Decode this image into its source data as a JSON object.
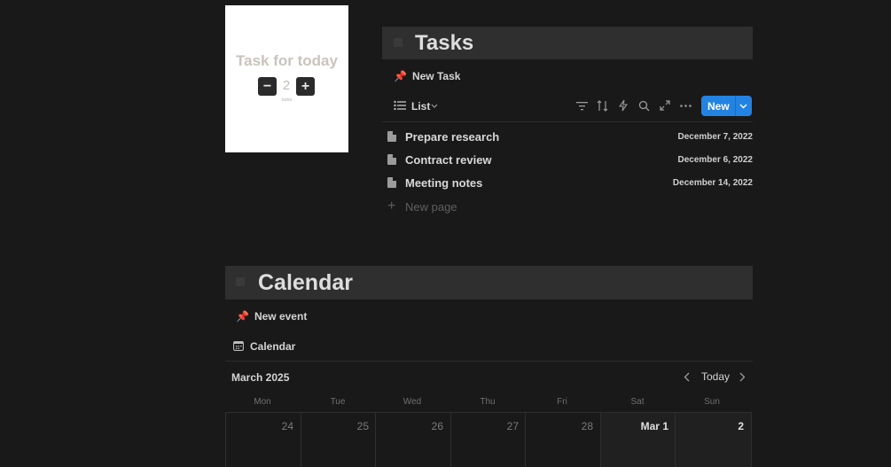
{
  "counter_widget": {
    "title": "Task for today",
    "value": "2",
    "minus_label": "−",
    "plus_label": "+",
    "sub_label": "tasks"
  },
  "tasks_section": {
    "title": "Tasks",
    "pinned_label": "New Task",
    "view_label": "List",
    "new_button_label": "New",
    "items": [
      {
        "title": "Prepare research",
        "date": "December 7, 2022"
      },
      {
        "title": "Contract review",
        "date": "December 6, 2022"
      },
      {
        "title": "Meeting notes",
        "date": "December 14, 2022"
      }
    ],
    "new_page_label": "New page"
  },
  "calendar_section": {
    "title": "Calendar",
    "pinned_label": "New event",
    "view_label": "Calendar",
    "month_label": "March 2025",
    "today_label": "Today",
    "weekdays": [
      "Mon",
      "Tue",
      "Wed",
      "Thu",
      "Fri",
      "Sat",
      "Sun"
    ],
    "days": [
      "24",
      "25",
      "26",
      "27",
      "28",
      "Mar 1",
      "2"
    ]
  },
  "icons": {
    "pin": "pushpin-icon",
    "list": "list-icon",
    "filter": "filter-icon",
    "sort": "sort-icon",
    "automation": "lightning-icon",
    "search": "search-icon",
    "expand": "expand-icon",
    "more": "more-icon",
    "document": "document-icon",
    "add": "plus-icon",
    "calendar": "calendar-icon"
  },
  "colors": {
    "background": "#191919",
    "header_bar": "#2f2f2f",
    "accent": "#2383e2",
    "pin": "#e0464a"
  }
}
